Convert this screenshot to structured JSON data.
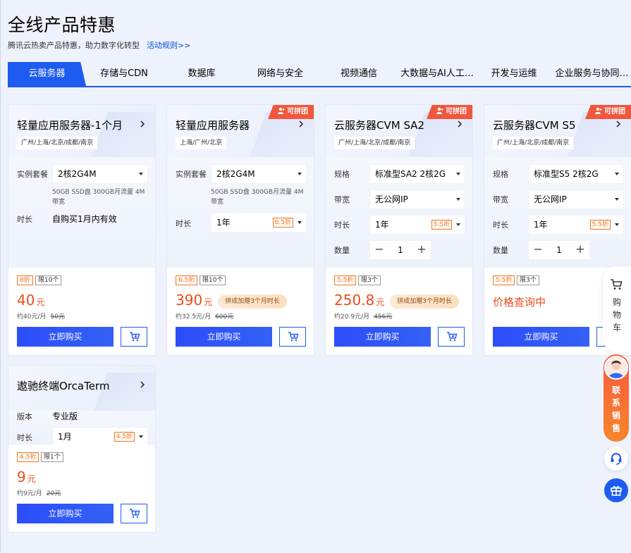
{
  "header": {
    "title": "全线产品特惠",
    "subtitle": "腾讯云热卖产品特惠，助力数字化转型",
    "rules_link": "活动规则>>"
  },
  "tabs": [
    {
      "label": "云服务器",
      "active": true
    },
    {
      "label": "存储与CDN"
    },
    {
      "label": "数据库"
    },
    {
      "label": "网络与安全"
    },
    {
      "label": "视频通信"
    },
    {
      "label": "大数据与AI人工…"
    },
    {
      "label": "开发与运维"
    },
    {
      "label": "企业服务与协同…"
    }
  ],
  "cards": [
    {
      "name": "轻量应用服务器-1个月",
      "region": "广州/上海/北京/成都/南京",
      "spec_label": "实例套餐",
      "spec_value": "2核2G4M",
      "spec_note": "50GB SSD盘 300GB月流量 4M带宽",
      "duration_label": "时长",
      "duration_value": "自购买1月内有效",
      "discount_tag": "8折",
      "limit_tag": "限10个",
      "price": "40",
      "price_unit": "元",
      "per_month": "约40元/月",
      "original": "50元",
      "buy_label": "立即购买"
    },
    {
      "name": "轻量应用服务器",
      "badge": "可拼团",
      "region": "上海/广州/北京",
      "spec_label": "实例套餐",
      "spec_value": "2核2G4M",
      "spec_note": "50GB SSD盘 300GB月流量 4M带宽",
      "duration_label": "时长",
      "duration_value": "1年",
      "duration_discount": "6.5折",
      "discount_tag": "6.5折",
      "limit_tag": "限10个",
      "price": "390",
      "price_unit": "元",
      "promo": "拼成加赠3个月时长",
      "per_month": "约32.5元/月",
      "original": "600元",
      "buy_label": "立即购买"
    },
    {
      "name": "云服务器CVM SA2",
      "badge": "可拼团",
      "region": "广州/上海/北京/成都/南京",
      "spec_label": "规格",
      "spec_value": "标准型SA2 2核2G",
      "bandwidth_label": "带宽",
      "bandwidth_value": "无公网IP",
      "duration_label": "时长",
      "duration_value": "1年",
      "duration_discount": "5.5折",
      "qty_label": "数量",
      "qty_value": "1",
      "discount_tag": "5.5折",
      "limit_tag": "限3个",
      "price": "250.8",
      "price_unit": "元",
      "promo": "拼成加赠3个月时长",
      "per_month": "约20.9元/月",
      "original": "456元",
      "buy_label": "立即购买"
    },
    {
      "name": "云服务器CVM S5",
      "badge": "可拼团",
      "region": "广州/上海/北京/成都/南京",
      "spec_label": "规格",
      "spec_value": "标准型S5 2核2G",
      "bandwidth_label": "带宽",
      "bandwidth_value": "无公网IP",
      "duration_label": "时长",
      "duration_value": "1年",
      "duration_discount": "5.5折",
      "qty_label": "数量",
      "qty_value": "1",
      "discount_tag": "5.5折",
      "limit_tag": "限3个",
      "price_text": "价格查询中",
      "buy_label": "立即购买"
    },
    {
      "name": "遨驰终端OrcaTerm",
      "version_label": "版本",
      "version_value": "专业版",
      "duration_label": "时长",
      "duration_value": "1月",
      "duration_discount": "4.5折",
      "discount_tag": "4.5折",
      "limit_tag": "限1个",
      "price": "9",
      "price_unit": "元",
      "per_month": "约9元/月",
      "original": "20元",
      "buy_label": "立即购买"
    }
  ],
  "sidebar": {
    "cart_label": "购物车",
    "sales_label": "联系销售"
  },
  "colors": {
    "brand_blue": "#1e5bf0",
    "price_red": "#ed4b1d",
    "discount_orange": "#ed7b2f",
    "badge_red": "#f0573c"
  }
}
